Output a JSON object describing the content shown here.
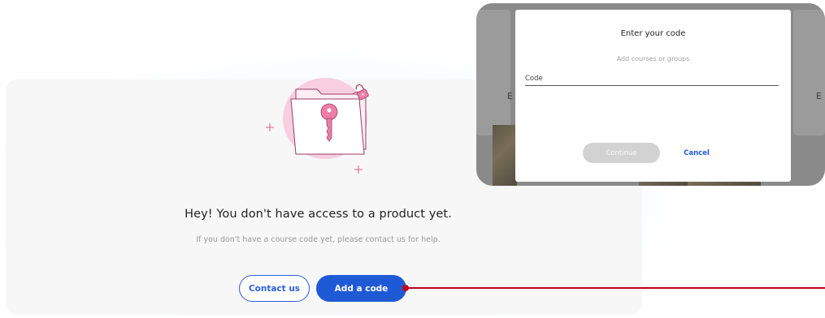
{
  "main": {
    "heading": "Hey! You don't have access to a product yet.",
    "subtext": "If you don't have a course code yet, please contact us for help.",
    "contact_label": "Contact us",
    "add_code_label": "Add a code"
  },
  "modal": {
    "title": "Enter your code",
    "subtitle": "Add courses or groups",
    "field_label": "Code",
    "field_value": "",
    "continue_label": "Continue",
    "cancel_label": "Cancel",
    "background_letters": [
      "E",
      "E"
    ]
  },
  "icons": {
    "illustration": "locked-folder-key-icon",
    "sparkles": [
      "plus-sparkle-icon",
      "plus-sparkle-icon"
    ]
  },
  "colors": {
    "primary": "#1f5ad6",
    "annotation_arrow": "#c3001c",
    "illustration_pink": "#f2a6c6"
  }
}
